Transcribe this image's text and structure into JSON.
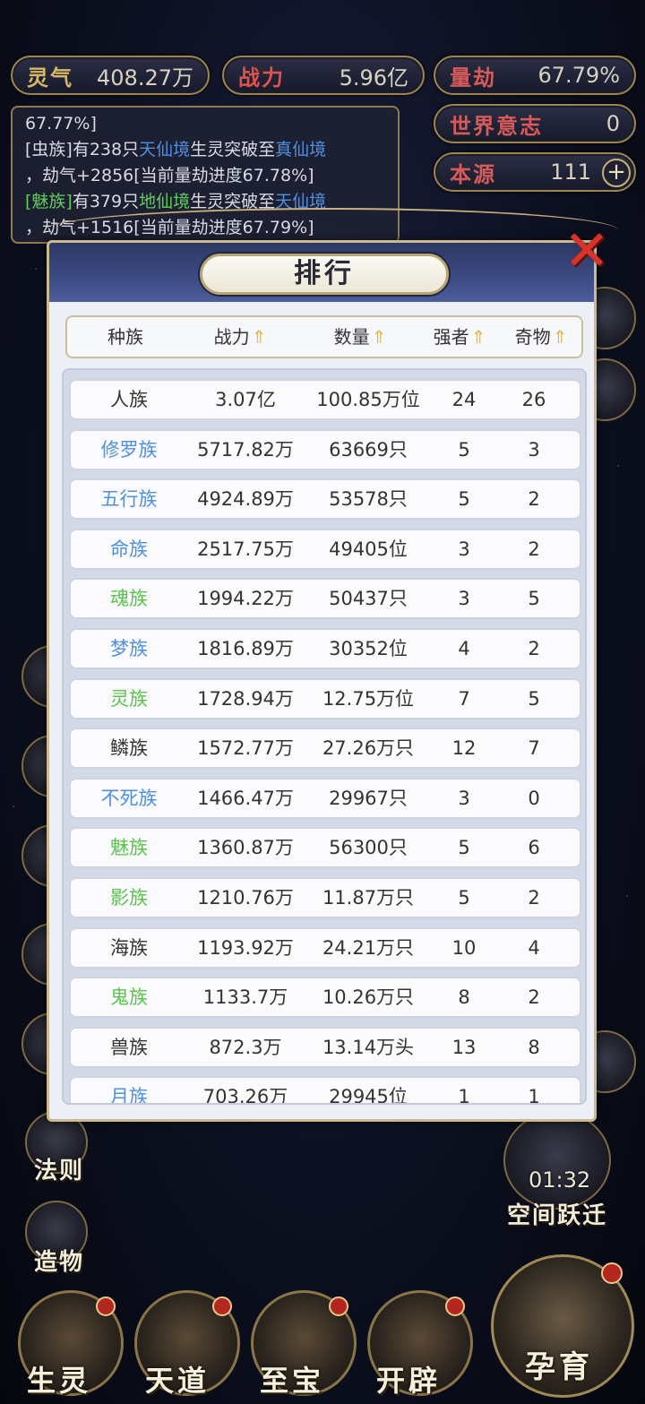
{
  "stats": {
    "lingqi": {
      "label": "灵气",
      "value": "408.27万"
    },
    "zhanli": {
      "label": "战力",
      "value": "5.96亿"
    },
    "liangjie": {
      "label": "量劫",
      "value": "67.79%"
    },
    "shijieyizhi": {
      "label": "世界意志",
      "value": "0"
    },
    "benyuan": {
      "label": "本源",
      "value": "111",
      "add_icon": "plus-icon"
    }
  },
  "log": {
    "line0": "67.77%]",
    "line1a": "[虫族]有238只",
    "line1b": "天仙境",
    "line1c": "生灵突破至",
    "line1d": "真仙境",
    "line2": "，劫气+2856[当前量劫进度67.78%]",
    "line3a": "[魅族]",
    "line3b": "有379只",
    "line3c": "地仙境",
    "line3d": "生灵突破至",
    "line3e": "天仙境",
    "line4": "，劫气+1516[当前量劫进度67.79%]"
  },
  "side": {
    "faze": "法则",
    "zaowu": "造物",
    "timer": "01:32",
    "kongjianyueqian": "空间跃迁"
  },
  "bottom": {
    "shengling": "生灵",
    "tiandao": "天道",
    "zhibao": "至宝",
    "kaipi": "开辟",
    "yunyu": "孕育"
  },
  "panel": {
    "title": "排行",
    "close_icon": "close-x-icon",
    "headers": {
      "race": "种族",
      "power": "战力",
      "count": "数量",
      "strong": "强者",
      "treasure": "奇物",
      "sort_icon": "sort-arrow-icon"
    },
    "rows": [
      {
        "name": "人族",
        "power": "3.07亿",
        "count": "100.85万位",
        "strong": "24",
        "treasure": "26",
        "color": "#333333"
      },
      {
        "name": "修罗族",
        "power": "5717.82万",
        "count": "63669只",
        "strong": "5",
        "treasure": "3",
        "color": "#4d8fe0"
      },
      {
        "name": "五行族",
        "power": "4924.89万",
        "count": "53578只",
        "strong": "5",
        "treasure": "2",
        "color": "#4d8fe0"
      },
      {
        "name": "命族",
        "power": "2517.75万",
        "count": "49405位",
        "strong": "3",
        "treasure": "2",
        "color": "#4d8fe0"
      },
      {
        "name": "魂族",
        "power": "1994.22万",
        "count": "50437只",
        "strong": "3",
        "treasure": "5",
        "color": "#59c34c"
      },
      {
        "name": "梦族",
        "power": "1816.89万",
        "count": "30352位",
        "strong": "4",
        "treasure": "2",
        "color": "#4d8fe0"
      },
      {
        "name": "灵族",
        "power": "1728.94万",
        "count": "12.75万位",
        "strong": "7",
        "treasure": "5",
        "color": "#59c34c"
      },
      {
        "name": "鳞族",
        "power": "1572.77万",
        "count": "27.26万只",
        "strong": "12",
        "treasure": "7",
        "color": "#333333"
      },
      {
        "name": "不死族",
        "power": "1466.47万",
        "count": "29967只",
        "strong": "3",
        "treasure": "0",
        "color": "#4d8fe0"
      },
      {
        "name": "魅族",
        "power": "1360.87万",
        "count": "56300只",
        "strong": "5",
        "treasure": "6",
        "color": "#59c34c"
      },
      {
        "name": "影族",
        "power": "1210.76万",
        "count": "11.87万只",
        "strong": "5",
        "treasure": "2",
        "color": "#59c34c"
      },
      {
        "name": "海族",
        "power": "1193.92万",
        "count": "24.21万只",
        "strong": "10",
        "treasure": "4",
        "color": "#333333"
      },
      {
        "name": "鬼族",
        "power": "1133.7万",
        "count": "10.26万只",
        "strong": "8",
        "treasure": "2",
        "color": "#59c34c"
      },
      {
        "name": "兽族",
        "power": "872.3万",
        "count": "13.14万头",
        "strong": "13",
        "treasure": "8",
        "color": "#333333"
      },
      {
        "name": "月族",
        "power": "703.26万",
        "count": "29945位",
        "strong": "1",
        "treasure": "1",
        "color": "#4d8fe0"
      }
    ]
  }
}
